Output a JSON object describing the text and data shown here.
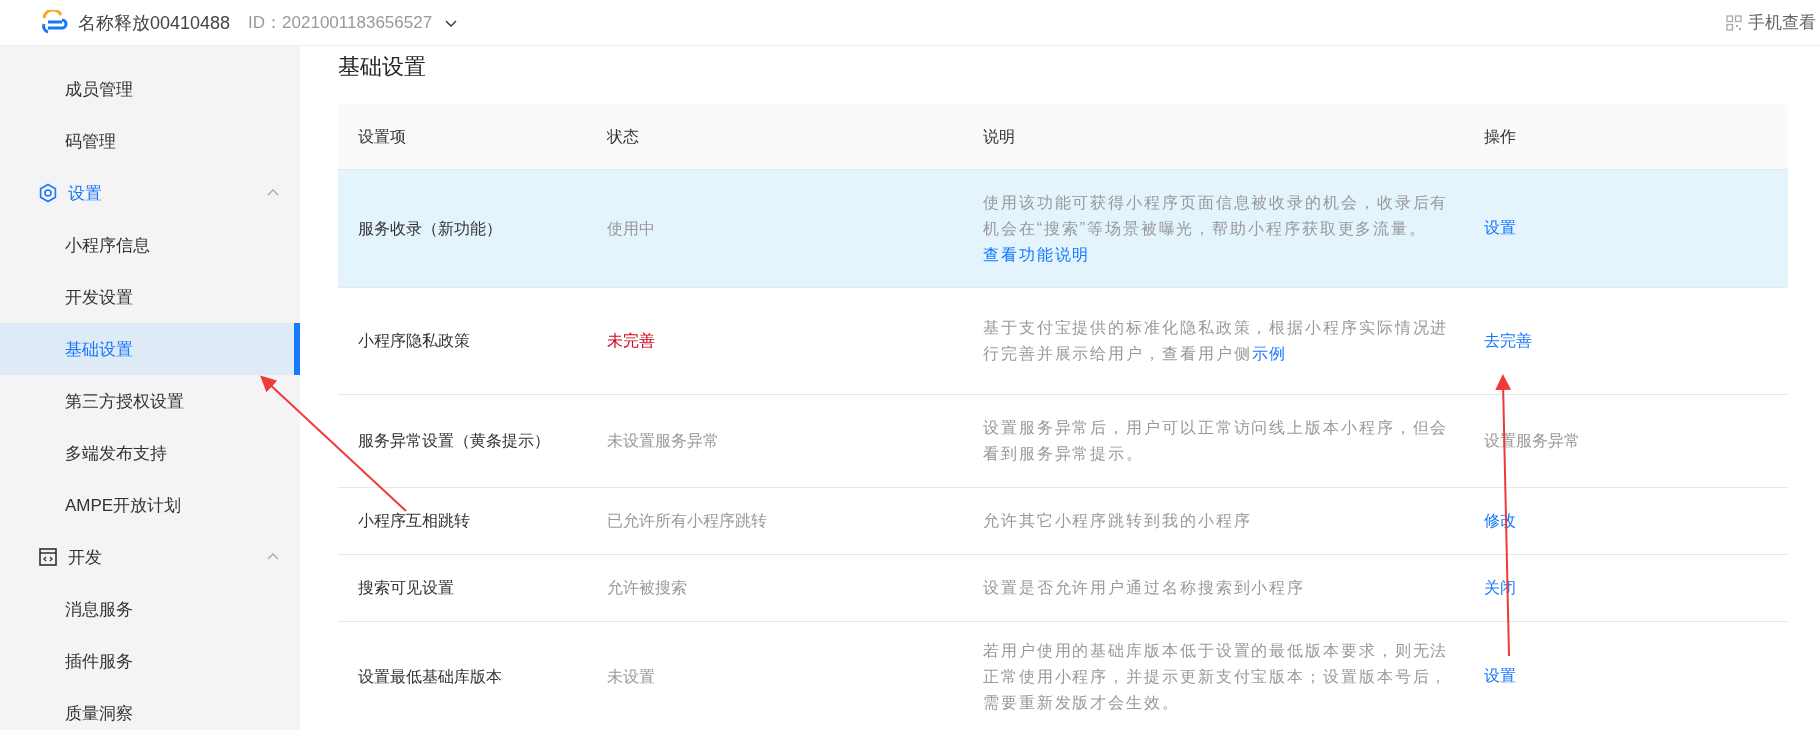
{
  "header": {
    "app_name": "名称释放00410488",
    "app_id": "ID：2021001183656527",
    "mobile_view": "手机查看"
  },
  "sidebar": {
    "sections": [
      {
        "items": [
          {
            "label": "成员管理",
            "selected": false
          },
          {
            "label": "码管理",
            "selected": false
          }
        ]
      },
      {
        "title": "设置",
        "active": true,
        "expanded": true,
        "items": [
          {
            "label": "小程序信息",
            "selected": false
          },
          {
            "label": "开发设置",
            "selected": false
          },
          {
            "label": "基础设置",
            "selected": true
          },
          {
            "label": "第三方授权设置",
            "selected": false
          },
          {
            "label": "多端发布支持",
            "selected": false
          },
          {
            "label": "AMPE开放计划",
            "selected": false
          }
        ]
      },
      {
        "title": "开发",
        "active": false,
        "expanded": true,
        "items": [
          {
            "label": "消息服务",
            "selected": false
          },
          {
            "label": "插件服务",
            "selected": false
          },
          {
            "label": "质量洞察",
            "selected": false
          }
        ]
      }
    ]
  },
  "page_title": "基础设置",
  "table": {
    "columns": [
      "设置项",
      "状态",
      "说明",
      "操作"
    ],
    "rows": [
      {
        "selected": true,
        "name": "服务收录（新功能）",
        "status": {
          "text": "使用中",
          "kind": "normal"
        },
        "description": {
          "text": "使用该功能可获得小程序页面信息被收录的机会，收录后有机会在“搜索”等场景被曝光，帮助小程序获取更多流量。",
          "link": "查看功能说明"
        },
        "action": {
          "text": "设置",
          "disabled": false
        }
      },
      {
        "selected": false,
        "name": "小程序隐私政策",
        "status": {
          "text": "未完善",
          "kind": "warning"
        },
        "description": {
          "text": "基于支付宝提供的标准化隐私政策，根据小程序实际情况进行完善并展示给用户，查看用户侧",
          "link": "示例"
        },
        "action": {
          "text": "去完善",
          "disabled": false
        }
      },
      {
        "selected": false,
        "name": "服务异常设置（黄条提示）",
        "status": {
          "text": "未设置服务异常",
          "kind": "normal"
        },
        "description": {
          "text": "设置服务异常后，用户可以正常访问线上版本小程序，但会看到服务异常提示。"
        },
        "action": {
          "text": "设置服务异常",
          "disabled": true
        }
      },
      {
        "selected": false,
        "name": "小程序互相跳转",
        "status": {
          "text": "已允许所有小程序跳转",
          "kind": "normal"
        },
        "description": {
          "text": "允许其它小程序跳转到我的小程序"
        },
        "action": {
          "text": "修改",
          "disabled": false
        }
      },
      {
        "selected": false,
        "name": "搜索可见设置",
        "status": {
          "text": "允许被搜索",
          "kind": "normal"
        },
        "description": {
          "text": "设置是否允许用户通过名称搜索到小程序"
        },
        "action": {
          "text": "关闭",
          "disabled": false
        }
      },
      {
        "selected": false,
        "name": "设置最低基础库版本",
        "status": {
          "text": "未设置",
          "kind": "normal"
        },
        "description": {
          "text": "若用户使用的基础库版本低于设置的最低版本要求，则无法正常使用小程序，并提示更新支付宝版本；设置版本号后，需要重新发版才会生效。"
        },
        "action": {
          "text": "设置",
          "disabled": false
        }
      }
    ]
  }
}
